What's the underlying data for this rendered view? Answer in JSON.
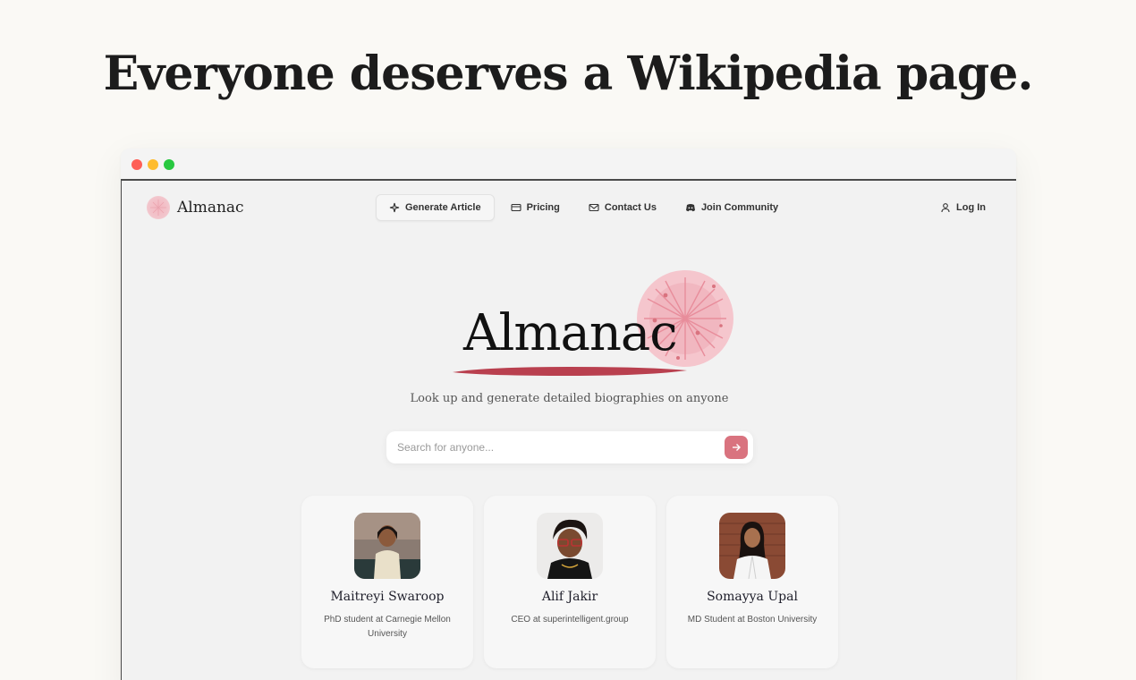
{
  "headline": "Everyone deserves a Wikipedia page.",
  "brand": {
    "name": "Almanac",
    "logo_icon": "almanac-logo-icon"
  },
  "nav": {
    "items": [
      {
        "label": "Generate Article",
        "icon": "sparkle-icon",
        "active": true
      },
      {
        "label": "Pricing",
        "icon": "credit-card-icon",
        "active": false
      },
      {
        "label": "Contact Us",
        "icon": "mail-icon",
        "active": false
      },
      {
        "label": "Join Community",
        "icon": "discord-icon",
        "active": false
      }
    ],
    "login": {
      "label": "Log In",
      "icon": "user-icon"
    }
  },
  "hero": {
    "title": "Almanac",
    "tagline": "Look up and generate detailed biographies on anyone"
  },
  "search": {
    "placeholder": "Search for anyone...",
    "value": "",
    "submit_icon": "arrow-right-icon"
  },
  "profiles": [
    {
      "name": "Maitreyi Swaroop",
      "role": "PhD student at Carnegie Mellon University"
    },
    {
      "name": "Alif Jakir",
      "role": "CEO at superintelligent.group"
    },
    {
      "name": "Somayya Upal",
      "role": "MD Student at Boston University"
    }
  ],
  "colors": {
    "accent": "#d9737f",
    "swoosh": "#b9404f",
    "burst": "#f3b8c2",
    "window_close": "#fe5f57",
    "window_minimize": "#febc2e",
    "window_maximize": "#28c840"
  }
}
